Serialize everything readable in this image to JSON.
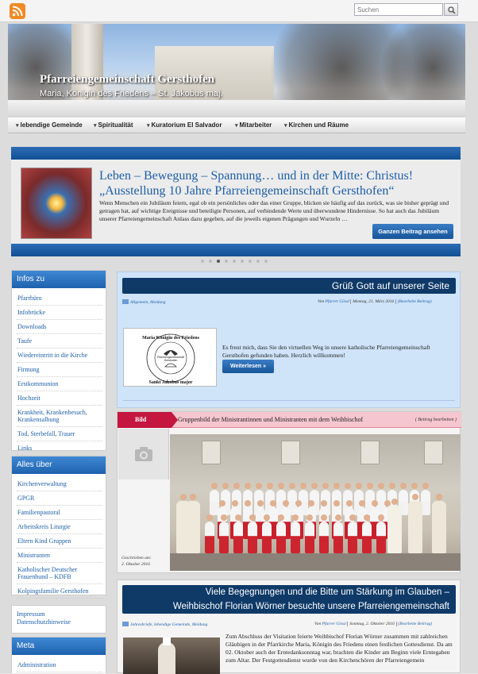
{
  "top": {
    "search_placeholder": "Suchen"
  },
  "header": {
    "title": "Pfarreiengemeinschaft Gersthofen",
    "subtitle": "Maria, Königin des Friedens – St. Jakobus maj."
  },
  "nav": {
    "items": [
      "lebendige Gemeinde",
      "Spiritualität",
      "Kuratorium El Salvador",
      "Mitarbeiter",
      "Kirchen und Räume"
    ]
  },
  "slider": {
    "title_line1": "Leben – Bewegung – Spannung… und in der Mitte: Christus!",
    "title_line2": "„Ausstellung 10 Jahre Pfarreiengemeinschaft Gersthofen“",
    "text": "Wenn Menschen ein Jubiläum feiern, egal ob ein persönliches oder das einer Gruppe, blicken sie häufig auf das zurück, was sie bisher geprägt und getragen hat, auf wichtige Ereignisse und beteiligte Personen, auf verbindende Werte und überwundene Hindernisse. So hat auch das Jubiläum unserer Pfarreiengemeinschaft Anlass dazu gegeben, auf die jeweils eigenen Prägungen und Wurzeln …",
    "button": "Ganzen Beitrag ansehen",
    "dot_count": 9,
    "active_dot": 3
  },
  "sidebar": {
    "infos_title": "Infos zu",
    "infos": [
      "Pfarrbüro",
      "Infobrücke",
      "Downloads",
      "Taufe",
      "Wiedereintritt in die Kirche",
      "Firmung",
      "Erstkommunion",
      "Hochzeit",
      "Krankheit, Krankenbesuch, Krankensalbung",
      "Tod, Sterbefall, Trauer",
      "Links"
    ],
    "alles_title": "Alles über",
    "alles": [
      "Kirchenverwaltung",
      "GPGR",
      "Familienpastoral",
      "Arbeitskreis Liturgie",
      "Eltern Kind Gruppen",
      "Ministranten",
      "Katholischer Deutscher Frauenbund – KDFB",
      "Kolpingsfamilie Gersthofen"
    ],
    "plain": [
      "Impressum",
      "Datenschutzhinweise"
    ],
    "meta_title": "Meta",
    "meta": [
      "Administration"
    ]
  },
  "post1": {
    "title": "Grüß Gott auf unserer Seite",
    "categories": "Allgemein, Meldung",
    "author_prefix": "Von",
    "author": "Pfarrer Gössl",
    "date": "Montag, 21. März 2016",
    "edit": "(Bearbeite Beitrag)",
    "text": "Es freut mich, dass Sie den virtuellen Weg in unsere katholische Pfarreiengemeinschaft Gersthofen gefunden haben. Herzlich willkommen!",
    "button": "Weiterlesen »",
    "logo_top": "Maria Königin des Friedens",
    "logo_mid1": "Pfarreiengemeinschaft",
    "logo_mid2": "Gersthofen",
    "logo_bottom": "Sankt Jakobus major"
  },
  "post2": {
    "tag": "Bild",
    "title": "Gruppenbild der Ministrantinnen und Ministranten mit dem Weihbischof",
    "edit": "( Beitrag bearbeiten )",
    "written": "Geschrieben am:",
    "date": "2. Oktober 2016"
  },
  "post3": {
    "title_line1": "Viele Begegnungen und die Bitte um Stärkung im Glauben –",
    "title_line2": "Weihbischof Florian Wörner besuchte unsere Pfarreiengemeinschaft",
    "categories": "Jahresbriefe, lebendige Gemeinde, Meldung",
    "author_prefix": "Von",
    "author": "Pfarrer Gössl",
    "date": "Sonntag, 2. Oktober 2016",
    "edit": "(Bearbeite Beitrag)",
    "text": "Zum Abschluss der Visitation feierte Weihbischof Florian Wörner zusammen mit zahlreichen Gläubigen in der Pfarrkirche Maria, Königin des Friedens einen festlichen Gottesdienst. Da am 02. Oktober auch der Erntedanksonntag war, brachten die Kinder am Beginn viele Erntegaben zum Altar. Der Festgottesdienst wurde von den Kirchenchören der Pfarreiengemein"
  },
  "colors": {
    "accent_blue": "#1d5ea8",
    "dark_navy": "#0f3a68",
    "rss_orange": "#f08a24",
    "bild_red": "#c4163f"
  },
  "icons": [
    "rss-icon",
    "search-icon",
    "chevron-down-icon",
    "folder-icon",
    "camera-icon"
  ]
}
